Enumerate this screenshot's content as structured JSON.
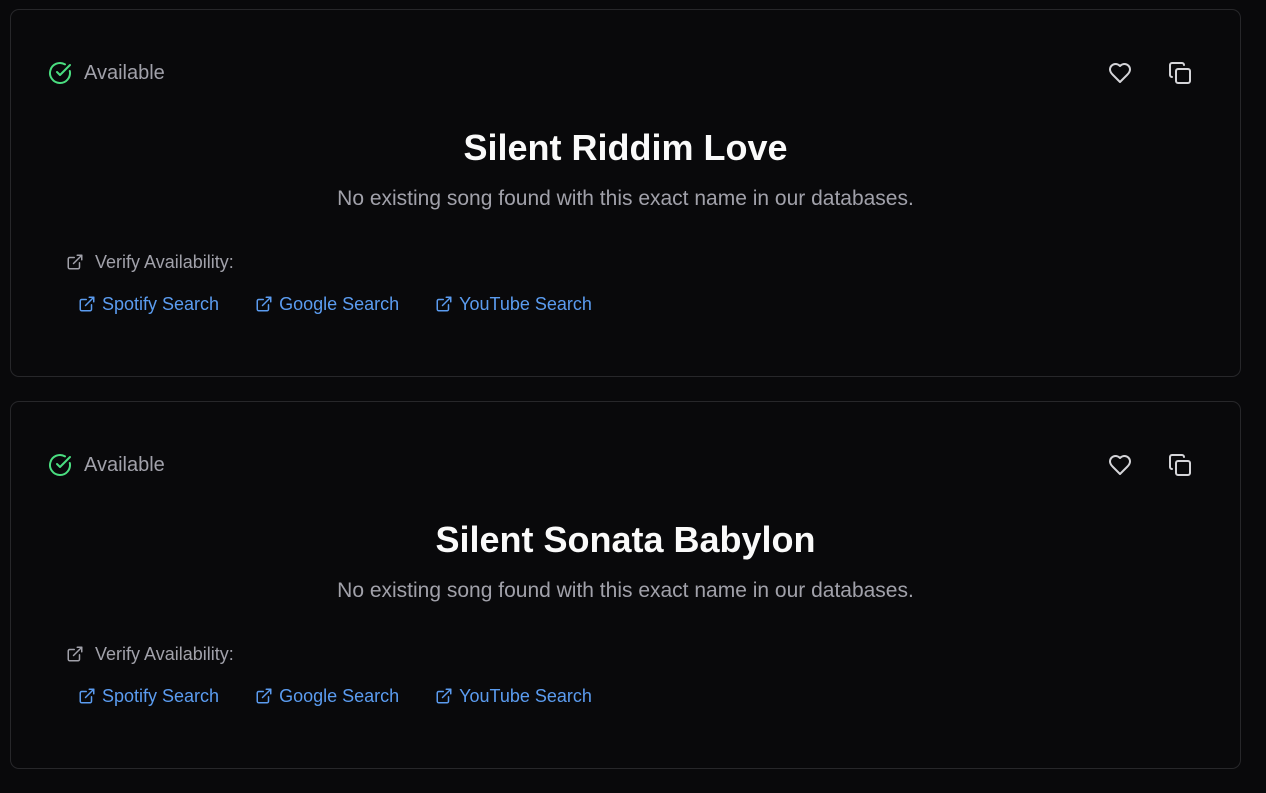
{
  "colors": {
    "background": "#09090b",
    "card_border": "#27272a",
    "available_green": "#4ade80",
    "link_blue": "#5b9cf0",
    "muted_text": "#a1a1aa",
    "title_text": "#fafafa"
  },
  "icons": {
    "status": "check-circle-icon",
    "favorite": "heart-icon",
    "copy": "copy-icon",
    "external": "external-link-icon"
  },
  "cards": [
    {
      "status": "Available",
      "title": "Silent Riddim Love",
      "subtitle": "No existing song found with this exact name in our databases.",
      "verify_label": "Verify Availability:",
      "links": [
        {
          "label": "Spotify Search"
        },
        {
          "label": "Google Search"
        },
        {
          "label": "YouTube Search"
        }
      ]
    },
    {
      "status": "Available",
      "title": "Silent Sonata Babylon",
      "subtitle": "No existing song found with this exact name in our databases.",
      "verify_label": "Verify Availability:",
      "links": [
        {
          "label": "Spotify Search"
        },
        {
          "label": "Google Search"
        },
        {
          "label": "YouTube Search"
        }
      ]
    }
  ]
}
